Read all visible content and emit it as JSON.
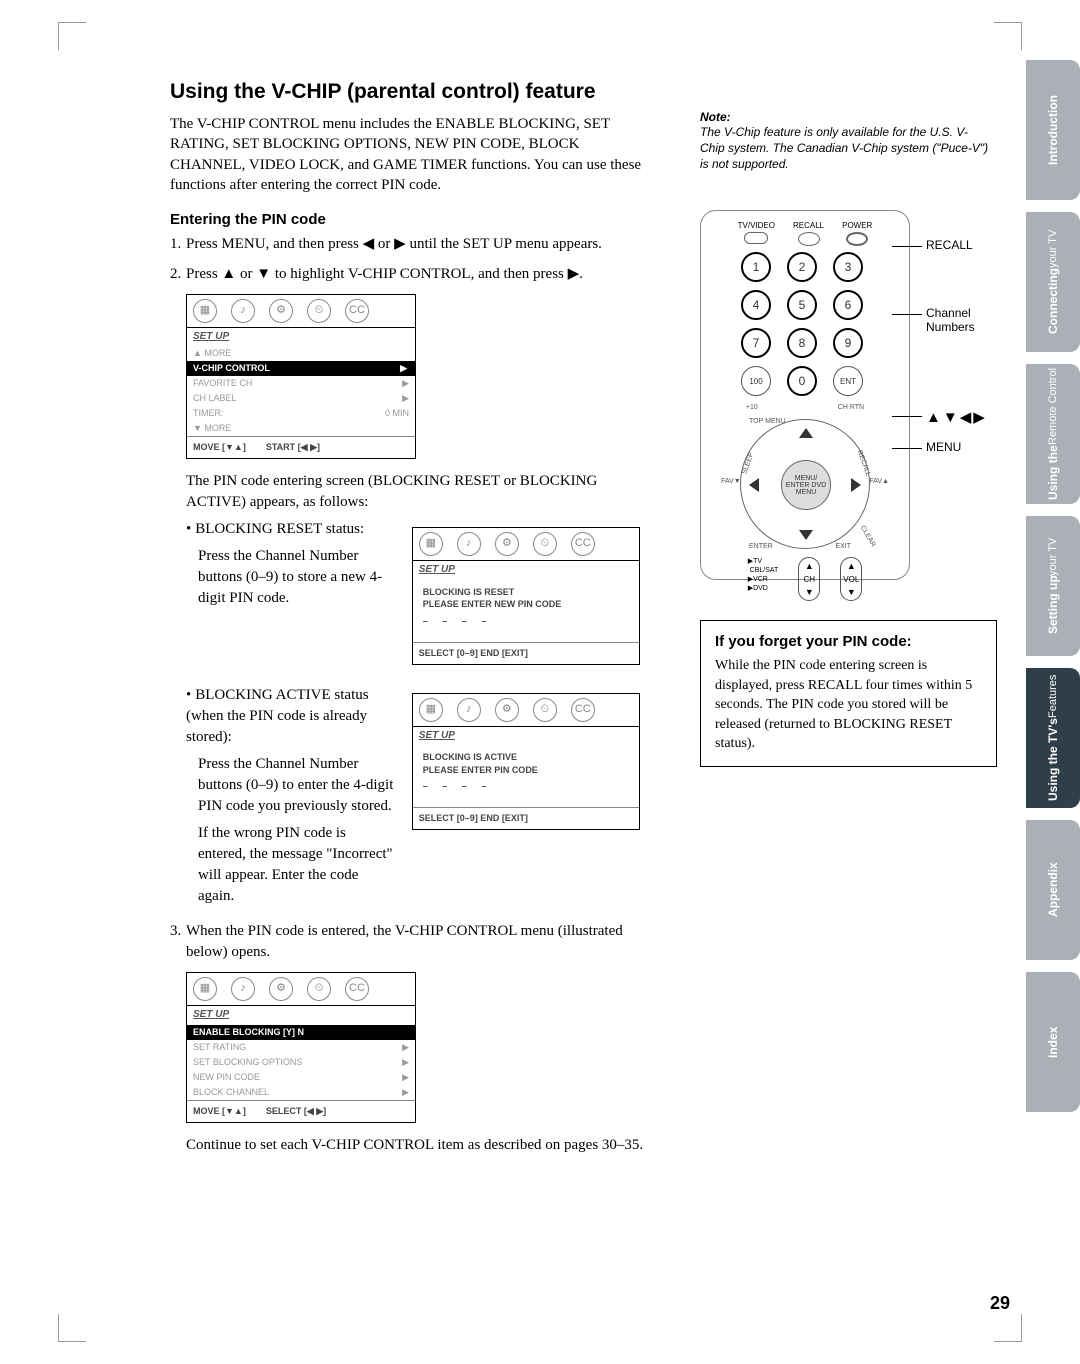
{
  "tabs": [
    {
      "label": "Introduction",
      "active": false
    },
    {
      "label": "Connecting",
      "sub": "your TV",
      "active": false
    },
    {
      "label": "Using the",
      "sub": "Remote Control",
      "active": false
    },
    {
      "label": "Setting up",
      "sub": "your TV",
      "active": false
    },
    {
      "label": "Using the TV's",
      "sub": "Features",
      "active": true
    },
    {
      "label": "Appendix",
      "active": false
    },
    {
      "label": "Index",
      "active": false
    }
  ],
  "title": "Using the V-CHIP (parental control) feature",
  "intro": "The V-CHIP CONTROL menu includes the ENABLE BLOCKING, SET RATING, SET BLOCKING OPTIONS, NEW PIN CODE, BLOCK CHANNEL, VIDEO LOCK, and GAME TIMER functions. You can use these functions after entering the correct PIN code.",
  "noteTitle": "Note:",
  "noteBody": "The V-Chip feature is only available for the U.S. V-Chip system. The Canadian V-Chip system (\"Puce-V\") is not supported.",
  "h2": "Entering the PIN code",
  "step1": "Press MENU, and then press ◀ or ▶ until the SET UP menu appears.",
  "step2": "Press ▲ or ▼ to highlight V-CHIP CONTROL, and then press ▶.",
  "menu1": {
    "title": "SET UP",
    "rows": [
      {
        "l": "▲ MORE",
        "r": ""
      },
      {
        "l": "V-CHIP CONTROL",
        "r": "▶",
        "hl": true
      },
      {
        "l": "FAVORITE CH",
        "r": "▶"
      },
      {
        "l": "CH LABEL",
        "r": "▶"
      },
      {
        "l": "TIMER:",
        "r": "0 MIN"
      },
      {
        "l": "▼ MORE",
        "r": ""
      }
    ],
    "footer": [
      "MOVE [▼▲]",
      "START [◀ ▶]"
    ]
  },
  "afterMenu1": "The PIN code entering screen (BLOCKING RESET or BLOCKING ACTIVE) appears, as follows:",
  "bullet1Title": "BLOCKING RESET status:",
  "bullet1Body": "Press the Channel Number buttons (0–9) to store a new 4-digit PIN code.",
  "menu2": {
    "title": "SET UP",
    "body1": "BLOCKING IS RESET",
    "body2": "PLEASE ENTER NEW PIN CODE",
    "dashes": "– – – –",
    "footer": "SELECT [0–9]   END [EXIT]"
  },
  "bullet2Title": "BLOCKING ACTIVE status (when the PIN code is already stored):",
  "bullet2Body": "Press the Channel Number buttons (0–9) to enter the 4-digit PIN code you previously stored.",
  "bullet2Body2": "If the wrong PIN code is entered, the message \"Incorrect\" will appear. Enter the code again.",
  "menu3": {
    "title": "SET UP",
    "body1": "BLOCKING IS ACTIVE",
    "body2": "PLEASE ENTER PIN CODE",
    "dashes": "– – – –",
    "footer": "SELECT [0–9]   END [EXIT]"
  },
  "step3": "When the PIN code is entered, the V-CHIP CONTROL menu (illustrated below) opens.",
  "menu4": {
    "title": "SET UP",
    "rows": [
      {
        "l": "ENABLE BLOCKING  [Y] N",
        "r": "",
        "hl": true
      },
      {
        "l": "SET RATING",
        "r": "▶"
      },
      {
        "l": "SET BLOCKING OPTIONS",
        "r": "▶"
      },
      {
        "l": "NEW PIN CODE",
        "r": "▶"
      },
      {
        "l": "BLOCK CHANNEL",
        "r": "▶"
      }
    ],
    "footer": [
      "MOVE [▼▲]",
      "SELECT [◀ ▶]"
    ]
  },
  "closing": "Continue to set each V-CHIP CONTROL item as described on pages 30–35.",
  "remote": {
    "top": [
      "TV/VIDEO",
      "RECALL",
      "POWER"
    ],
    "chrtn": "CH RTN",
    "plus10": "+10",
    "ent": "ENT",
    "center": "MENU/\nENTER\nDVD MENU",
    "ringLabels": {
      "tl": "TOP MENU",
      "l": "SLEEP",
      "r": "RECALL",
      "bl": "ENTER",
      "br": "EXIT",
      "brr": "CLEAR"
    },
    "favL": "FAV▼",
    "favR": "FAV▲",
    "rockerL": "CH",
    "rockerR": "VOL",
    "modes": "▶TV\n CBL/SAT\n▶VCR\n▶DVD",
    "co1": "RECALL",
    "co2a": "Channel",
    "co2b": "Numbers",
    "co3": "▲▼◀▶",
    "co4": "MENU"
  },
  "forgotTitle": "If you forget your PIN code:",
  "forgotBody": "While the PIN code entering screen is displayed, press RECALL four times within 5 seconds. The PIN code you stored will be released (returned to BLOCKING RESET status).",
  "pageNum": "29"
}
